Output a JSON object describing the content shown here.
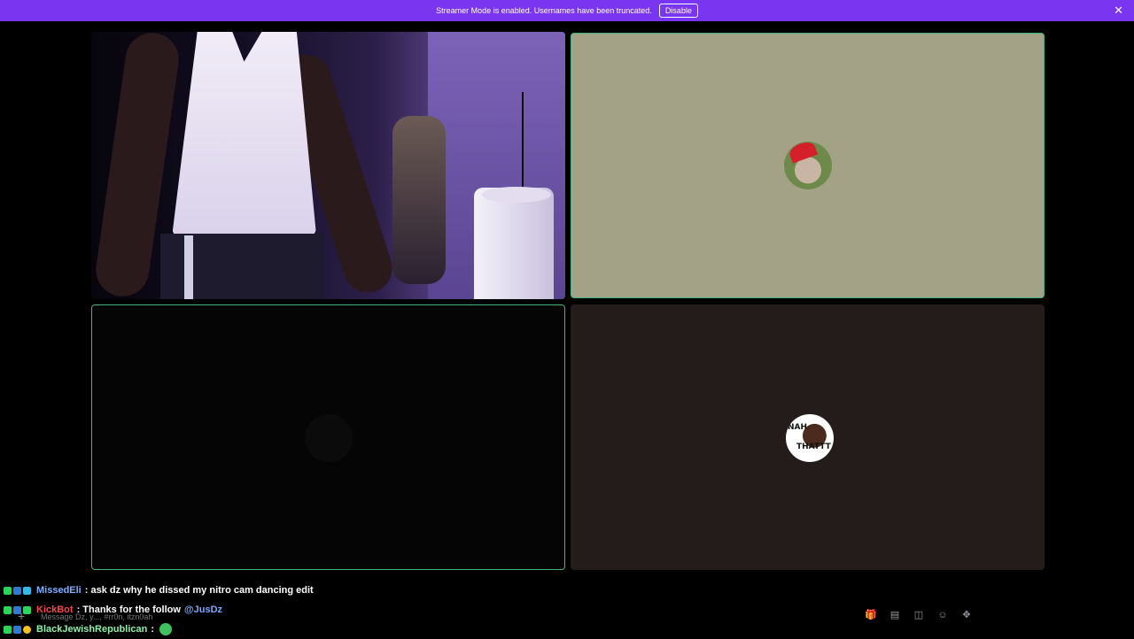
{
  "banner": {
    "message": "Streamer Mode is enabled. Usernames have been truncated.",
    "disable_label": "Disable",
    "close_glyph": "✕",
    "color": "#7a35f0"
  },
  "video_grid": {
    "tiles": [
      {
        "kind": "camera",
        "speaking": false
      },
      {
        "kind": "avatar",
        "speaking": true
      },
      {
        "kind": "avatar",
        "speaking": true
      },
      {
        "kind": "avatar",
        "speaking": false
      }
    ],
    "avatar4_text_top": "NAH",
    "avatar4_text_bottom": "THATTT",
    "speaking_border_color": "#43b581"
  },
  "chat": {
    "messages": [
      {
        "username": "MissedEli",
        "username_color": "#7fb0ff",
        "text": ": ask dz why he dissed my nitro cam dancing edit",
        "mention": ""
      },
      {
        "username": "KickBot",
        "username_color": "#ff4545",
        "text": ": Thanks for the follow",
        "mention": "@JusDz"
      },
      {
        "username": "BlackJewishRepublican",
        "username_color": "#8ef0a8",
        "text": ":",
        "mention": ""
      }
    ]
  },
  "composer": {
    "placeholder": "Message Dz, y..., #rr0n, itzn0ah",
    "plus_glyph": "+",
    "icons": [
      "gift-icon",
      "gif-icon",
      "sticker-icon",
      "emoji-icon",
      "apps-icon"
    ],
    "icon_glyphs": [
      "🎁",
      "▤",
      "◫",
      "☺",
      "✥"
    ]
  }
}
